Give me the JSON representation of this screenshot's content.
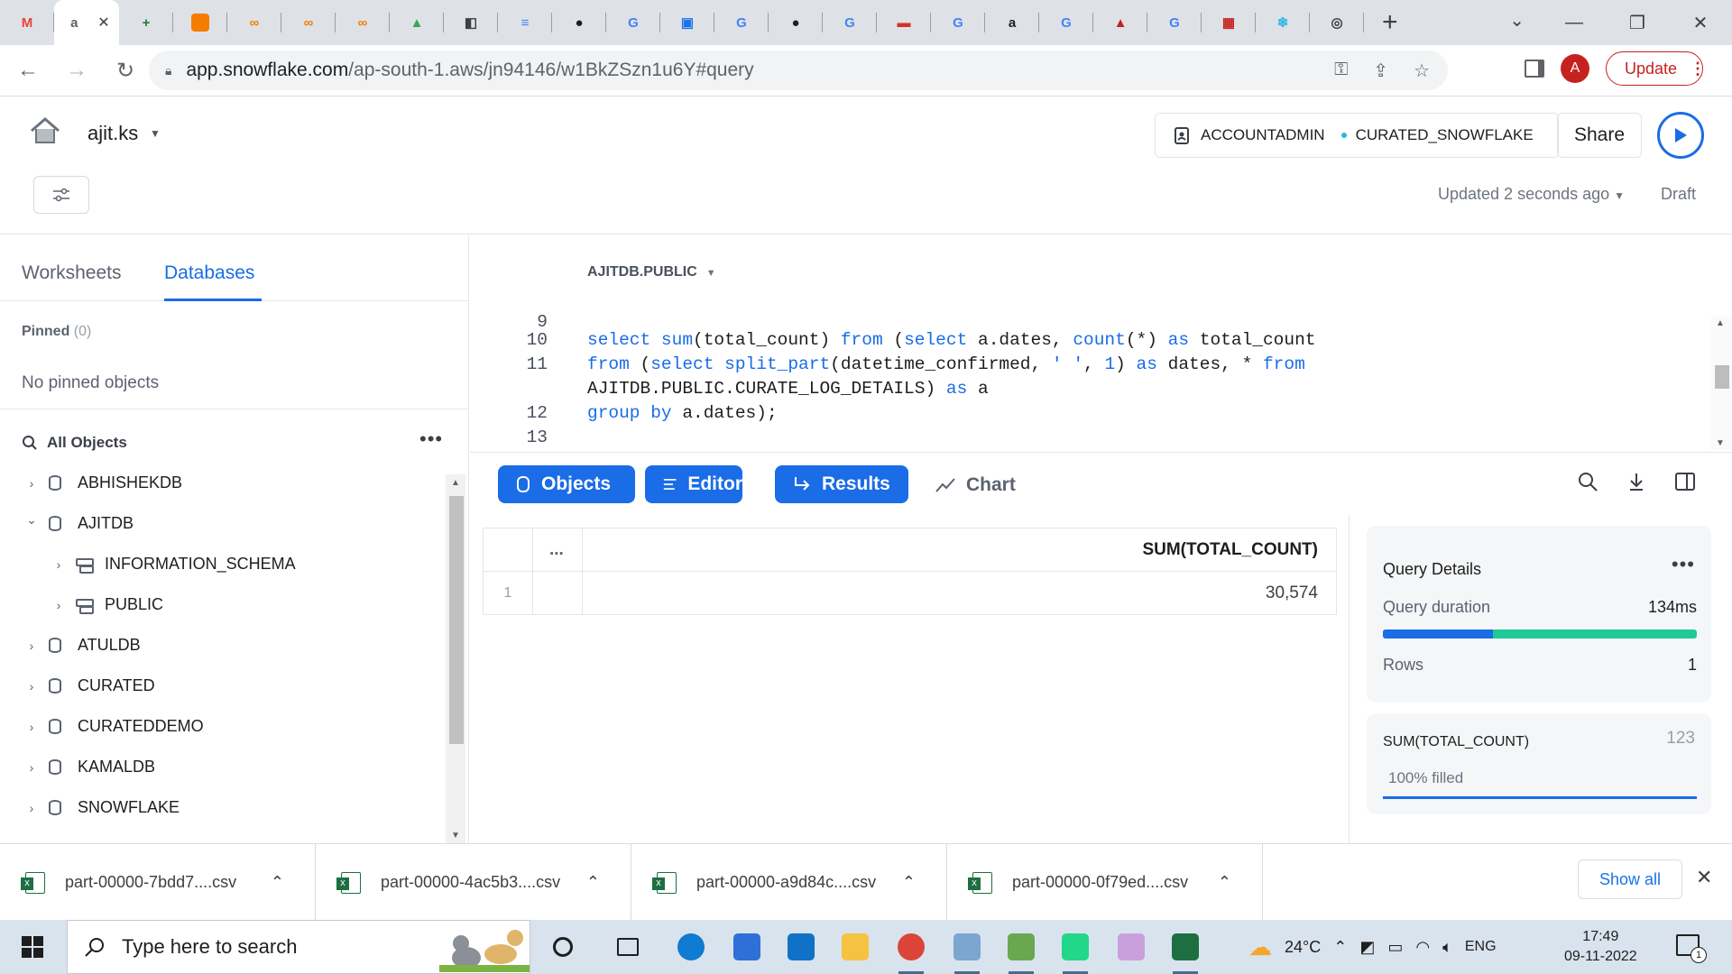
{
  "browser": {
    "tabs": [
      {
        "icon": "gmail-icon",
        "label": "M",
        "color": "#ea4335"
      },
      {
        "icon": "active-tab-icon",
        "label": "a",
        "color": "#5f6368",
        "active": true
      },
      {
        "icon": "sheets-plus-icon",
        "label": "+",
        "color": "#188038"
      },
      {
        "icon": "orange-cube-icon",
        "label": "",
        "color": "#f57c00"
      },
      {
        "icon": "infinity-icon",
        "label": "∞",
        "color": "#f57c00"
      },
      {
        "icon": "infinity-icon",
        "label": "∞",
        "color": "#f57c00"
      },
      {
        "icon": "infinity-icon",
        "label": "∞",
        "color": "#f57c00"
      },
      {
        "icon": "drive-icon",
        "label": "▲",
        "color": "#34a853"
      },
      {
        "icon": "code-icon",
        "label": "◧",
        "color": "#3c4043"
      },
      {
        "icon": "docs-icon",
        "label": "≡",
        "color": "#4285f4"
      },
      {
        "icon": "github-icon",
        "label": "●",
        "color": "#1e1e1e"
      },
      {
        "icon": "google-icon",
        "label": "G",
        "color": "#4285f4"
      },
      {
        "icon": "monitor-icon",
        "label": "▣",
        "color": "#1a73e8"
      },
      {
        "icon": "google-icon",
        "label": "G",
        "color": "#4285f4"
      },
      {
        "icon": "github-icon",
        "label": "●",
        "color": "#1e1e1e"
      },
      {
        "icon": "google-icon",
        "label": "G",
        "color": "#4285f4"
      },
      {
        "icon": "red-banner-icon",
        "label": "▬",
        "color": "#d93025"
      },
      {
        "icon": "google-icon",
        "label": "G",
        "color": "#4285f4"
      },
      {
        "icon": "amazon-icon",
        "label": "a",
        "color": "#1e1e1e"
      },
      {
        "icon": "google-icon",
        "label": "G",
        "color": "#4285f4"
      },
      {
        "icon": "red-triangle-icon",
        "label": "▲",
        "color": "#c5221f"
      },
      {
        "icon": "google-icon",
        "label": "G",
        "color": "#4285f4"
      },
      {
        "icon": "red-logo-icon",
        "label": "▦",
        "color": "#c5221f"
      },
      {
        "icon": "snowflake-icon",
        "label": "❄",
        "color": "#29b5e8"
      },
      {
        "icon": "openai-icon",
        "label": "◎",
        "color": "#3c4043"
      }
    ],
    "address": {
      "domain": "app.snowflake.com",
      "path": "/ap-south-1.aws/jn94146/w1BkZSzn1u6Y#query"
    },
    "profile_initial": "A",
    "update_label": "Update"
  },
  "header": {
    "user": "ajit.ks",
    "role": "ACCOUNTADMIN",
    "warehouse": "CURATED_SNOWFLAKE",
    "share_label": "Share",
    "updated": "Updated 2 seconds ago",
    "status": "Draft"
  },
  "left_panel": {
    "tabs": [
      "Worksheets",
      "Databases"
    ],
    "active_tab": "Databases",
    "pinned_label": "Pinned",
    "pinned_count": "(0)",
    "no_pinned": "No pinned objects",
    "all_objects": "All Objects",
    "tree": [
      {
        "name": "ABHISHEKDB",
        "level": 0,
        "expanded": false,
        "kind": "database"
      },
      {
        "name": "AJITDB",
        "level": 0,
        "expanded": true,
        "kind": "database"
      },
      {
        "name": "INFORMATION_SCHEMA",
        "level": 1,
        "expanded": false,
        "kind": "schema"
      },
      {
        "name": "PUBLIC",
        "level": 1,
        "expanded": false,
        "kind": "schema"
      },
      {
        "name": "ATULDB",
        "level": 0,
        "expanded": false,
        "kind": "database"
      },
      {
        "name": "CURATED",
        "level": 0,
        "expanded": false,
        "kind": "database"
      },
      {
        "name": "CURATEDDEMO",
        "level": 0,
        "expanded": false,
        "kind": "database"
      },
      {
        "name": "KAMALDB",
        "level": 0,
        "expanded": false,
        "kind": "database"
      },
      {
        "name": "SNOWFLAKE",
        "level": 0,
        "expanded": false,
        "kind": "database"
      }
    ]
  },
  "editor": {
    "context": "AJITDB.PUBLIC",
    "lines": [
      {
        "n": "9",
        "html": ""
      },
      {
        "n": "10",
        "html": "<span class=\"k\">select</span> <span class=\"k\">sum</span>(total_count) <span class=\"k\">from</span> (<span class=\"k\">select</span> a.dates, <span class=\"k\">count</span>(*) <span class=\"k\">as</span> total_count"
      },
      {
        "n": "11",
        "html": "<span class=\"k\">from</span> (<span class=\"k\">select</span> <span class=\"k\">split_part</span>(datetime_confirmed, <span class=\"s\">' '</span>, <span class=\"s\">1</span>) <span class=\"k\">as</span> dates, * <span class=\"k\">from</span>"
      },
      {
        "n": "",
        "html": "AJITDB.PUBLIC.CURATE_LOG_DETAILS) <span class=\"k\">as</span> a"
      },
      {
        "n": "12",
        "html": "<span class=\"k\">group by</span> a.dates);"
      },
      {
        "n": "13",
        "html": ""
      }
    ]
  },
  "results_toolbar": {
    "objects": "Objects",
    "editor": "Editor",
    "results": "Results",
    "chart": "Chart"
  },
  "results": {
    "dots": "...",
    "column": "SUM(TOTAL_COUNT)",
    "rows": [
      {
        "idx": "1",
        "value": "30,574"
      }
    ]
  },
  "query_details": {
    "title": "Query Details",
    "duration_label": "Query duration",
    "duration_value": "134ms",
    "duration_split": 0.35,
    "rows_label": "Rows",
    "rows_value": "1",
    "column_name": "SUM(TOTAL_COUNT)",
    "column_type": "123",
    "filled": "100% filled"
  },
  "downloads": {
    "items": [
      "part-00000-7bdd7....csv",
      "part-00000-4ac5b3....csv",
      "part-00000-a9d84c....csv",
      "part-00000-0f79ed....csv"
    ],
    "show_all": "Show all"
  },
  "taskbar": {
    "search_placeholder": "Type here to search",
    "weather": "24°C",
    "lang": "ENG",
    "time": "17:49",
    "date": "09-11-2022",
    "notifications": "1",
    "apps": [
      {
        "name": "cortana",
        "color": "#1e1e1e"
      },
      {
        "name": "task-view",
        "color": "#1e1e1e"
      },
      {
        "name": "edge",
        "color": "#0f7bd1"
      },
      {
        "name": "store",
        "color": "#2f6fd8"
      },
      {
        "name": "mail",
        "color": "#1072c7"
      },
      {
        "name": "file-explorer",
        "color": "#f5c242"
      },
      {
        "name": "chrome",
        "color": "#db4437"
      },
      {
        "name": "app-blue",
        "color": "#7ba6cf"
      },
      {
        "name": "app-green",
        "color": "#6aa84f"
      },
      {
        "name": "pycharm",
        "color": "#21d789"
      },
      {
        "name": "paint",
        "color": "#c9a0dc"
      },
      {
        "name": "excel",
        "color": "#1d6f42"
      }
    ]
  }
}
